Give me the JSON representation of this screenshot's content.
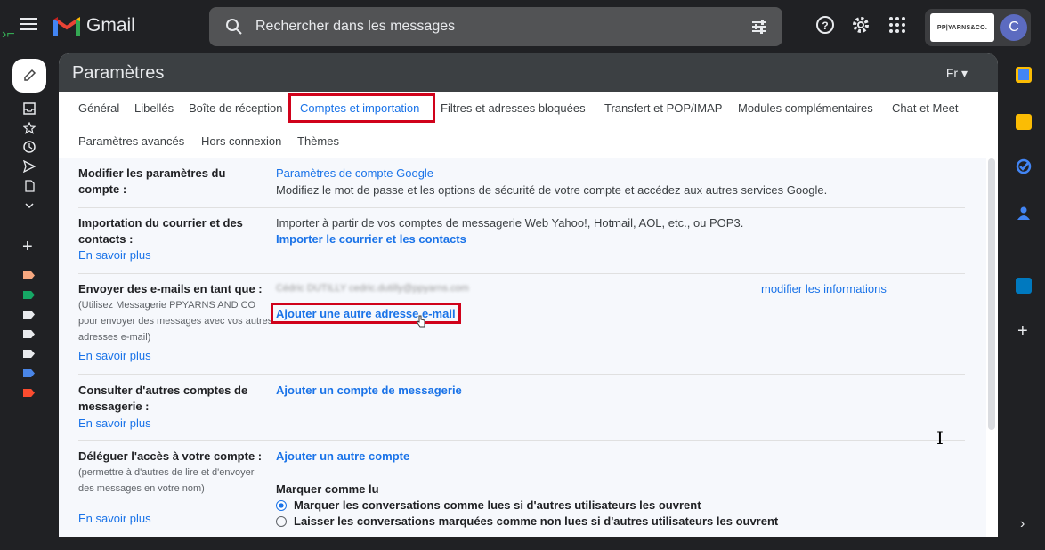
{
  "app": {
    "name": "Gmail"
  },
  "search": {
    "placeholder": "Rechercher dans les messages"
  },
  "account": {
    "brand": "PP|YARNS&CO.",
    "avatar_initial": "C"
  },
  "panel": {
    "title": "Paramètres",
    "language": "Fr ▾"
  },
  "tabs": [
    {
      "label": "Général"
    },
    {
      "label": "Libellés"
    },
    {
      "label": "Boîte de réception"
    },
    {
      "label": "Comptes et importation",
      "active": true
    },
    {
      "label": "Filtres et adresses bloquées"
    },
    {
      "label": "Transfert et POP/IMAP"
    },
    {
      "label": "Modules complémentaires"
    },
    {
      "label": "Chat et Meet"
    },
    {
      "label": "Paramètres avancés"
    },
    {
      "label": "Hors connexion"
    },
    {
      "label": "Thèmes"
    }
  ],
  "sections": {
    "account": {
      "label": "Modifier les paramètres du compte :",
      "link": "Paramètres de compte Google",
      "description": "Modifiez le mot de passe et les options de sécurité de votre compte et accédez aux autres services Google."
    },
    "import": {
      "label": "Importation du courrier et des contacts :",
      "learn_more": "En savoir plus",
      "description": "Importer à partir de vos comptes de messagerie Web Yahoo!, Hotmail, AOL, etc., ou POP3.",
      "action": "Importer le courrier et les contacts"
    },
    "send_as": {
      "label": "Envoyer des e-mails en tant que :",
      "note": "(Utilisez Messagerie PPYARNS AND CO pour envoyer des messages avec vos autres adresses e-mail)",
      "learn_more": "En savoir plus",
      "address_blurred": "Cédric DUTILLY cedric.dutilly@ppyarns.com",
      "edit_link": "modifier les informations",
      "add_link": "Ajouter une autre adresse e-mail"
    },
    "check_mail": {
      "label": "Consulter d'autres comptes de messagerie :",
      "learn_more": "En savoir plus",
      "action": "Ajouter un compte de messagerie"
    },
    "delegate": {
      "label": "Déléguer l'accès à votre compte :",
      "note": "(permettre à d'autres de lire et d'envoyer des messages en votre nom)",
      "learn_more": "En savoir plus",
      "action": "Ajouter un autre compte",
      "mark_as_read_title": "Marquer comme lu",
      "options": [
        {
          "label": "Marquer les conversations comme lues si d'autres utilisateurs les ouvrent",
          "selected": true
        },
        {
          "label": "Laisser les conversations marquées comme non lues si d'autres utilisateurs les ouvrent",
          "selected": false
        }
      ]
    }
  },
  "colors": {
    "accent": "#1a73e8",
    "highlight": "#d0021b",
    "dark_bg": "#202124"
  }
}
